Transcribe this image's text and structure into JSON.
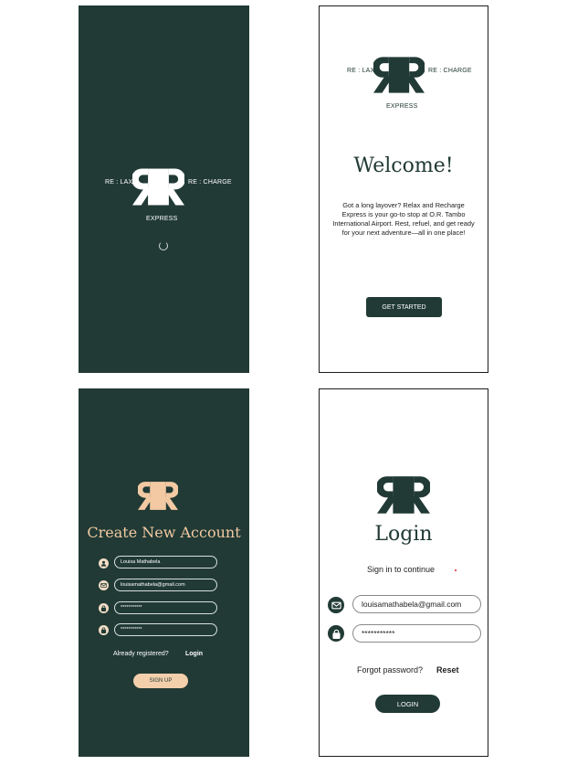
{
  "brand": {
    "left_tag": "RE : LAX",
    "right_tag": "RE : CHARGE",
    "sub_tag": "EXPRESS"
  },
  "welcome": {
    "title": "Welcome!",
    "body": "Got a long layover? Relax and Recharge Express is your go-to stop at O.R. Tambo International Airport. Rest, refuel, and get ready for your next adventure—all in one place!",
    "button": "GET STARTED"
  },
  "signup": {
    "title": "Create New Account",
    "name_value": "Louisa Mathabela",
    "email_value": "louisamathabela@gmail.com",
    "password_value": "***********",
    "confirm_value": "***********",
    "already_text": "Already registered?",
    "login_link": "Login",
    "button": "SIGN UP"
  },
  "login": {
    "title": "Login",
    "subtitle": "Sign in to continue",
    "email_value": "louisamathabela@gmail.com",
    "password_value": "***********",
    "forgot_text": "Forgot password?",
    "reset_link": "Reset",
    "button": "LOGIN"
  },
  "icons": {
    "logo": "rr-logo",
    "spinner": "loading-spinner-icon",
    "user": "user-icon",
    "mail": "mail-icon",
    "lock": "lock-icon"
  },
  "colors": {
    "dark_green": "#213a35",
    "peach": "#f2c9a2",
    "white": "#ffffff"
  }
}
